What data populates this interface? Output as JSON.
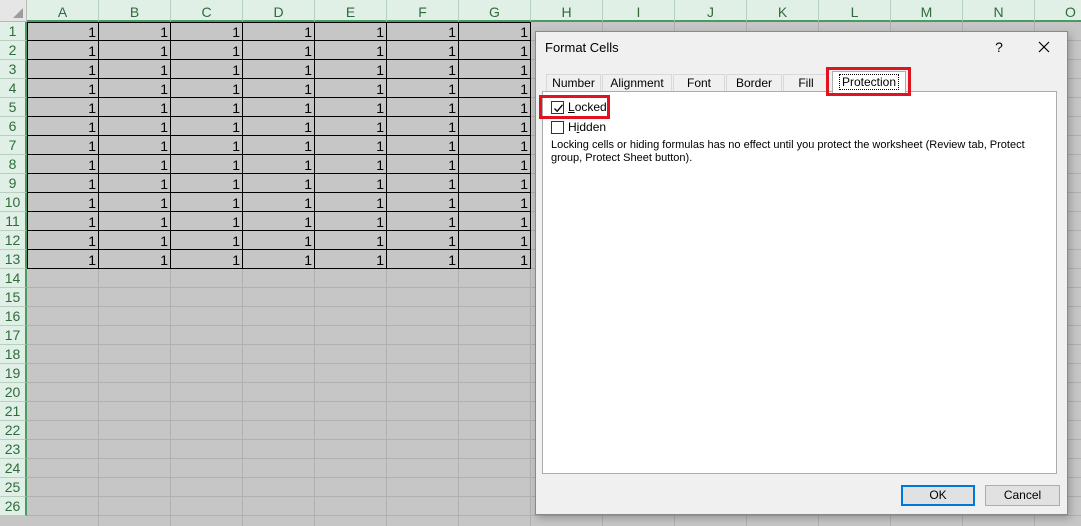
{
  "sheet": {
    "columns": [
      "A",
      "B",
      "C",
      "D",
      "E",
      "F",
      "G",
      "H",
      "I",
      "J",
      "K",
      "L",
      "M",
      "N",
      "O"
    ],
    "rows": [
      "1",
      "2",
      "3",
      "4",
      "5",
      "6",
      "7",
      "8",
      "9",
      "10",
      "11",
      "12",
      "13",
      "14",
      "15",
      "16",
      "17",
      "18",
      "19",
      "20",
      "21",
      "22",
      "23",
      "24",
      "25",
      "26"
    ],
    "cell_value": "1",
    "filled_rows": 13,
    "filled_columns": 7
  },
  "dialog": {
    "title": "Format Cells",
    "help_label": "?",
    "tabs": [
      {
        "label": "Number"
      },
      {
        "label": "Alignment"
      },
      {
        "label": "Font"
      },
      {
        "label": "Border"
      },
      {
        "label": "Fill"
      },
      {
        "label": "Protection",
        "active": true
      }
    ],
    "locked": {
      "label": "Locked",
      "checked": true
    },
    "hidden": {
      "label": "Hidden",
      "checked": false
    },
    "info_text": "Locking cells or hiding formulas has no effect until you protect the worksheet (Review tab, Protect group, Protect Sheet button).",
    "ok_label": "OK",
    "cancel_label": "Cancel"
  },
  "colors": {
    "highlight": "#e0141e",
    "header_green": "#4a9b63"
  }
}
